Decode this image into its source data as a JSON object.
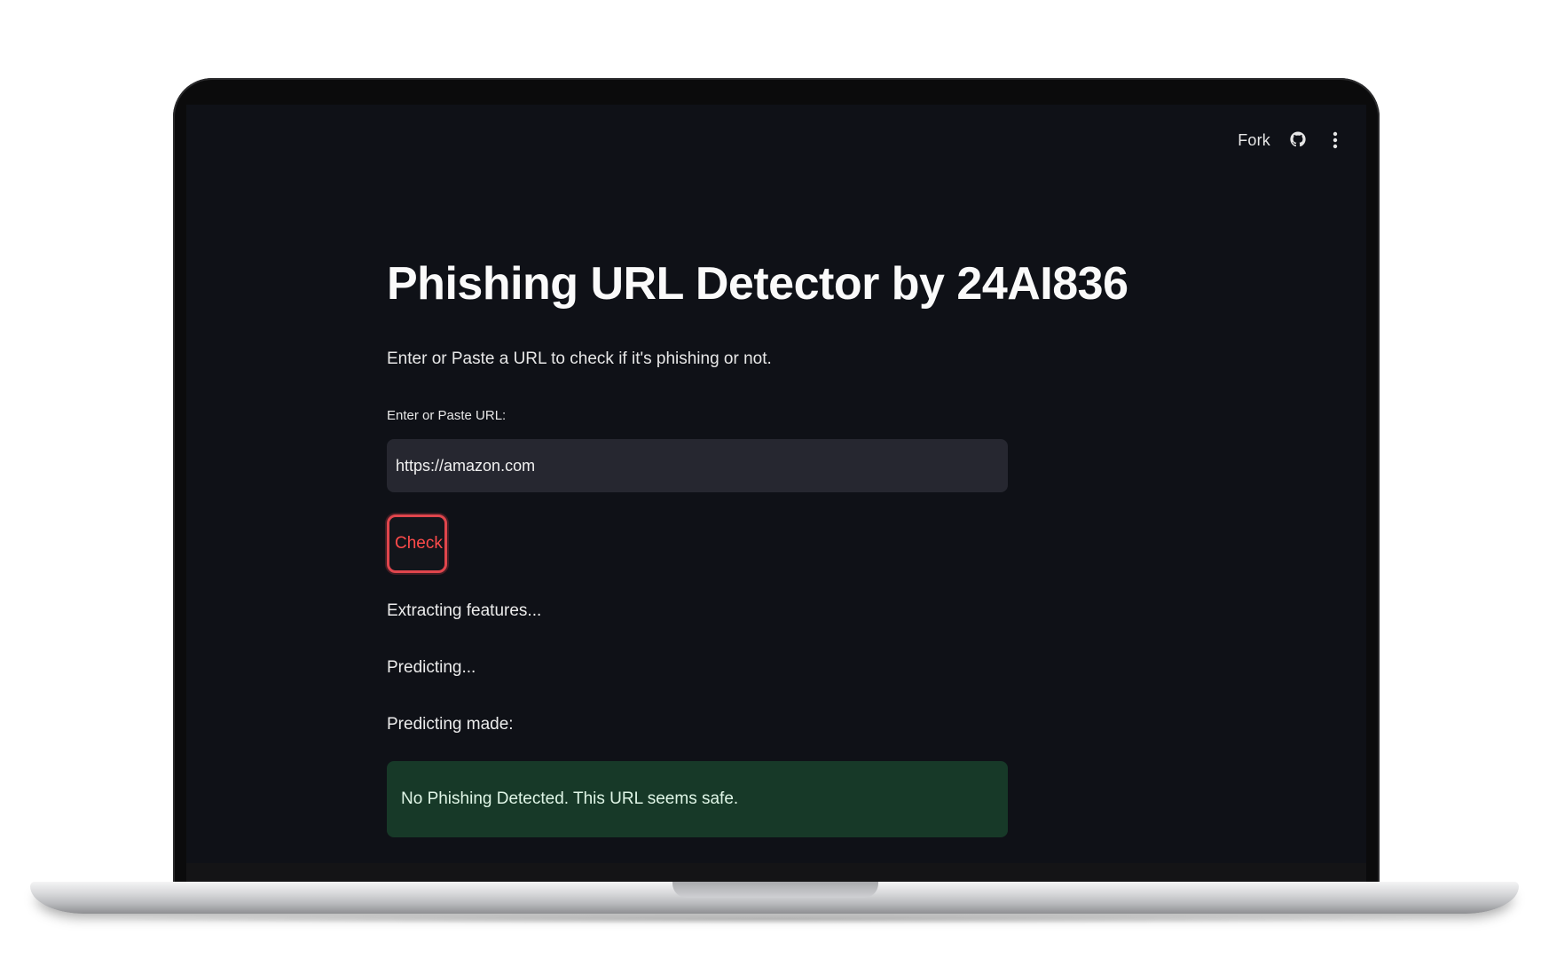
{
  "toolbar": {
    "fork_label": "Fork",
    "github_icon": "github-icon",
    "menu_icon": "more-vertical-icon"
  },
  "app": {
    "title": "Phishing URL Detector by 24AI836",
    "subtitle": "Enter or Paste a URL to check if it's phishing or not.",
    "input_label": "Enter or Paste URL:",
    "input_value": "https://amazon.com",
    "check_label": "Check",
    "status_lines": [
      "Extracting features...",
      "Predicting...",
      "Predicting made:"
    ],
    "result_text": "No Phishing Detected. This URL seems safe."
  },
  "colors": {
    "background": "#0f1117",
    "input_bg": "#262730",
    "accent_red": "#ff4b4b",
    "success_bg": "#173928",
    "success_text": "#dff5e6"
  }
}
